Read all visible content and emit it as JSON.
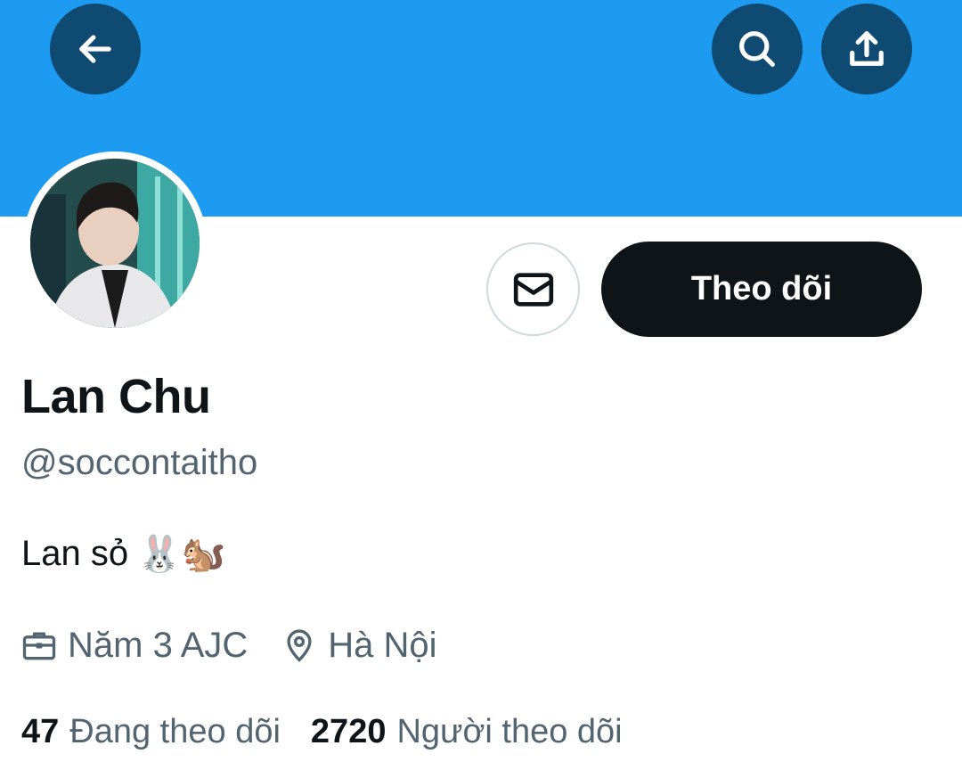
{
  "header": {
    "back_icon": "arrow-left-icon",
    "search_icon": "search-icon",
    "share_icon": "share-upload-icon",
    "banner_color": "#1d9bf0",
    "button_bg": "#0f4a73"
  },
  "actions": {
    "message_icon": "envelope-icon",
    "follow_label": "Theo dõi"
  },
  "profile": {
    "display_name": "Lan Chu",
    "handle": "@soccontaitho",
    "bio_text": "Lan sỏ",
    "bio_emoji": "🐰🐿️",
    "work_icon": "briefcase-icon",
    "work": "Năm 3 AJC",
    "location_icon": "location-pin-icon",
    "location": "Hà Nội"
  },
  "stats": {
    "following_count": "47",
    "following_label": "Đang theo dõi",
    "followers_count": "2720",
    "followers_label": "Người theo dõi"
  }
}
